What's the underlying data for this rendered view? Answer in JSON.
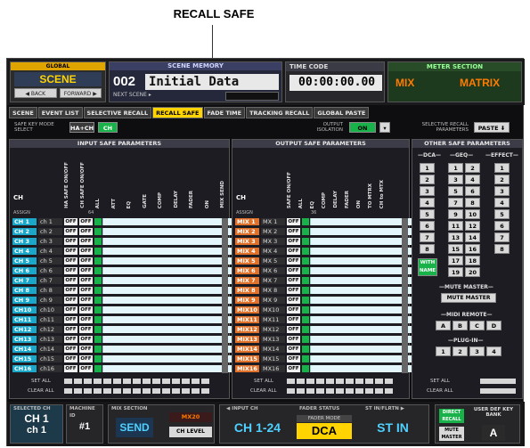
{
  "callout": "RECALL SAFE",
  "top": {
    "global_label": "GLOBAL",
    "scene_label": "SCENE",
    "back_label": "◀ BACK",
    "forward_label": "FORWARD ▶",
    "scene_memory_title": "SCENE MEMORY",
    "scene_number": "002",
    "scene_name": "Initial Data",
    "next_scene_label": "NEXT SCENE ▸",
    "timecode_title": "TIME CODE",
    "timecode_value": "00:00:00.00",
    "meter_title": "METER SECTION",
    "meter_mix": "MIX",
    "meter_matrix": "MATRIX"
  },
  "tabs": [
    "SCENE",
    "EVENT LIST",
    "SELECTIVE RECALL",
    "RECALL SAFE",
    "FADE TIME",
    "TRACKING RECALL",
    "GLOBAL PASTE"
  ],
  "active_tab": 3,
  "mode": {
    "safe_key_label": "SAFE KEY MODE SELECT",
    "ha_ch": "HA+CH",
    "ch": "CH",
    "output_isolation_label": "OUTPUT ISOLATION",
    "on": "ON",
    "selective_recall_label": "SELECTIVE RECALL PARAMETERS",
    "paste": "PASTE ⬇"
  },
  "input": {
    "title": "INPUT SAFE PARAMETERS",
    "ch_header": "CH",
    "assign_label": "ASSIGN",
    "count": "64",
    "columns": [
      "HA SAFE ON/OFF",
      "CH SAFE ON/OFF",
      "ALL",
      "ATT",
      "EQ",
      "GATE",
      "COMP",
      "DELAY",
      "FADER",
      "ON",
      "MIX SEND"
    ],
    "rows": [
      {
        "ch": "CH 1",
        "name": "ch 1"
      },
      {
        "ch": "CH 2",
        "name": "ch 2"
      },
      {
        "ch": "CH 3",
        "name": "ch 3"
      },
      {
        "ch": "CH 4",
        "name": "ch 4"
      },
      {
        "ch": "CH 5",
        "name": "ch 5"
      },
      {
        "ch": "CH 6",
        "name": "ch 6"
      },
      {
        "ch": "CH 7",
        "name": "ch 7"
      },
      {
        "ch": "CH 8",
        "name": "ch 8"
      },
      {
        "ch": "CH 9",
        "name": "ch 9"
      },
      {
        "ch": "CH10",
        "name": "ch10"
      },
      {
        "ch": "CH11",
        "name": "ch11"
      },
      {
        "ch": "CH12",
        "name": "ch12"
      },
      {
        "ch": "CH13",
        "name": "ch13"
      },
      {
        "ch": "CH14",
        "name": "ch14"
      },
      {
        "ch": "CH15",
        "name": "ch15"
      },
      {
        "ch": "CH16",
        "name": "ch16"
      }
    ],
    "off": "OFF",
    "set_all": "SET ALL",
    "clear_all": "CLEAR ALL"
  },
  "output": {
    "title": "OUTPUT SAFE PARAMETERS",
    "ch_header": "CH",
    "assign_label": "ASSIGN",
    "count": "36",
    "columns": [
      "SAFE ON/OFF",
      "ALL",
      "EQ",
      "COMP",
      "DELAY",
      "FADER",
      "ON",
      "TO MTRX",
      "CH to MTX"
    ],
    "rows": [
      {
        "ch": "MIX 1",
        "name": "MX 1"
      },
      {
        "ch": "MIX 2",
        "name": "MX 2"
      },
      {
        "ch": "MIX 3",
        "name": "MX 3"
      },
      {
        "ch": "MIX 4",
        "name": "MX 4"
      },
      {
        "ch": "MIX 5",
        "name": "MX 5"
      },
      {
        "ch": "MIX 6",
        "name": "MX 6"
      },
      {
        "ch": "MIX 7",
        "name": "MX 7"
      },
      {
        "ch": "MIX 8",
        "name": "MX 8"
      },
      {
        "ch": "MIX 9",
        "name": "MX 9"
      },
      {
        "ch": "MIX10",
        "name": "MX10"
      },
      {
        "ch": "MIX11",
        "name": "MX11"
      },
      {
        "ch": "MIX12",
        "name": "MX12"
      },
      {
        "ch": "MIX13",
        "name": "MX13"
      },
      {
        "ch": "MIX14",
        "name": "MX14"
      },
      {
        "ch": "MIX15",
        "name": "MX15"
      },
      {
        "ch": "MIX16",
        "name": "MX16"
      }
    ],
    "off": "OFF",
    "set_all": "SET ALL",
    "clear_all": "CLEAR ALL"
  },
  "other": {
    "title": "OTHER SAFE PARAMETERS",
    "dca_label": "DCA",
    "geq_label": "GEQ",
    "effect_label": "EFFECT",
    "dca": [
      "1",
      "2",
      "3",
      "4",
      "5",
      "6",
      "7",
      "8"
    ],
    "geq": [
      "1",
      "2",
      "3",
      "4",
      "5",
      "6",
      "7",
      "8",
      "9",
      "10",
      "11",
      "12",
      "13",
      "14",
      "15",
      "16",
      "17",
      "18",
      "19",
      "20"
    ],
    "effect": [
      "1",
      "2",
      "3",
      "4",
      "5",
      "6",
      "7",
      "8"
    ],
    "with_name": "WITH NAME",
    "mute_master_label": "MUTE MASTER",
    "mute_master_btn": "MUTE MASTER",
    "midi_remote_label": "MIDI REMOTE",
    "midi": [
      "A",
      "B",
      "C",
      "D"
    ],
    "plug_in_label": "PLUG-IN",
    "plug": [
      "1",
      "2",
      "3",
      "4"
    ],
    "set_all": "SET ALL",
    "clear_all": "CLEAR ALL"
  },
  "bottom": {
    "selected_ch_label": "SELECTED CH",
    "selected_ch": "CH 1",
    "selected_name": "ch 1",
    "machine_id_label": "MACHINE ID",
    "machine_id": "#1",
    "mix_section_label": "MIX SECTION",
    "send": "SEND",
    "mx": "MX20",
    "ch_level": "CH LEVEL",
    "input_ch_label": "◀ INPUT CH",
    "input_ch": "CH 1-24",
    "fader_status_label": "FADER STATUS",
    "fader_mode_label": "FADER MODE",
    "dca": "DCA",
    "st_in_label": "ST IN/FLRTN ▶",
    "st_in": "ST IN",
    "direct_recall": "DIRECT RECALL",
    "mute_master": "MUTE MASTER",
    "user_def_label": "USER DEF KEY BANK",
    "bank": "A"
  },
  "colors": {
    "accent": "#ffd400",
    "input_ch": "#1aa7c9",
    "output_ch": "#e0712a",
    "safe_green": "#19b24a"
  }
}
